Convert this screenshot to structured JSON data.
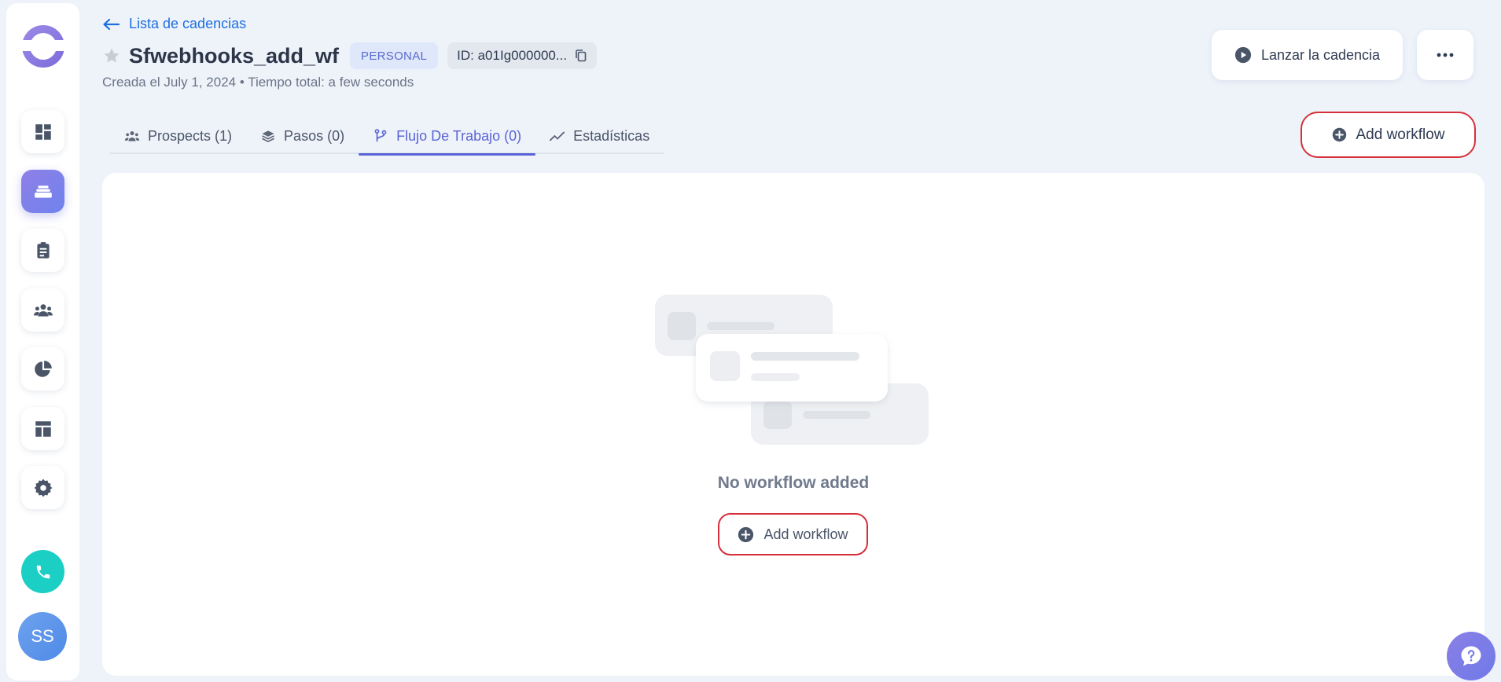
{
  "header": {
    "back_label": "Lista de cadencias",
    "title": "Sfwebhooks_add_wf",
    "badge": "PERSONAL",
    "id_label": "ID: a01Ig000000...",
    "subtitle": "Creada el July 1, 2024 • Tiempo total: a few seconds",
    "launch_label": "Lanzar la cadencia"
  },
  "tabs": [
    {
      "label": "Prospects (1)",
      "icon": "users-icon",
      "active": false
    },
    {
      "label": "Pasos (0)",
      "icon": "layers-icon",
      "active": false
    },
    {
      "label": "Flujo De Trabajo (0)",
      "icon": "branch-icon",
      "active": true
    },
    {
      "label": "Estadísticas",
      "icon": "trend-icon",
      "active": false
    }
  ],
  "actions": {
    "add_workflow_label": "Add workflow"
  },
  "empty_state": {
    "message": "No workflow added",
    "button_label": "Add workflow"
  },
  "sidebar": {
    "avatar_initials": "SS",
    "items": [
      "dashboard-icon",
      "cadences-icon",
      "tasks-icon",
      "team-icon",
      "reports-icon",
      "templates-icon",
      "settings-icon"
    ]
  },
  "colors": {
    "accent": "#5a63d6",
    "link": "#1d6fe0",
    "highlight": "#d6303a",
    "phone": "#1ccfc4"
  }
}
